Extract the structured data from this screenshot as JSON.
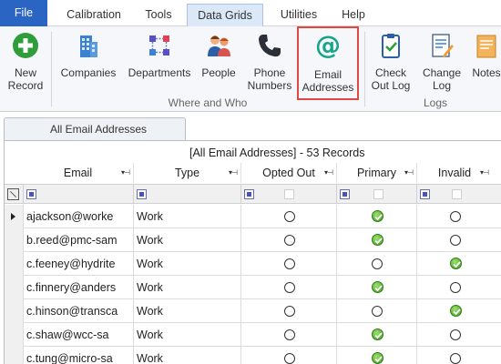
{
  "menu": {
    "file": "File",
    "calibration": "Calibration",
    "tools": "Tools",
    "data_grids": "Data Grids",
    "utilities": "Utilities",
    "help": "Help"
  },
  "ribbon": {
    "new_record": [
      "New",
      "Record"
    ],
    "companies": "Companies",
    "departments": "Departments",
    "people": "People",
    "phone_numbers": [
      "Phone",
      "Numbers"
    ],
    "email_addresses": [
      "Email",
      "Addresses"
    ],
    "check_out_log": [
      "Check",
      "Out Log"
    ],
    "change_log": [
      "Change",
      "Log"
    ],
    "notes": "Notes",
    "group_where_who": "Where and Who",
    "group_logs": "Logs"
  },
  "tab": {
    "label": "All Email Addresses"
  },
  "grid": {
    "caption": "[All Email Addresses] - 53 Records",
    "columns": [
      "Email",
      "Type",
      "Opted Out",
      "Primary",
      "Invalid"
    ],
    "rows": [
      {
        "email": "ajackson@worke",
        "type": "Work",
        "opted_out": false,
        "primary": true,
        "invalid": false,
        "current": true
      },
      {
        "email": "b.reed@pmc-sam",
        "type": "Work",
        "opted_out": false,
        "primary": true,
        "invalid": false
      },
      {
        "email": "c.feeney@hydrite",
        "type": "Work",
        "opted_out": false,
        "primary": false,
        "invalid": true
      },
      {
        "email": "c.finnery@anders",
        "type": "Work",
        "opted_out": false,
        "primary": true,
        "invalid": false
      },
      {
        "email": "c.hinson@transca",
        "type": "Work",
        "opted_out": false,
        "primary": false,
        "invalid": true
      },
      {
        "email": "c.shaw@wcc-sa",
        "type": "Work",
        "opted_out": false,
        "primary": true,
        "invalid": false
      },
      {
        "email": "c.tung@micro-sa",
        "type": "Work",
        "opted_out": false,
        "primary": true,
        "invalid": false
      }
    ]
  },
  "colors": {
    "file_tab": "#2b65c4",
    "active_tab": "#dbe8f7",
    "selected_button_border": "#e04848",
    "check_green": "#3e9b1c",
    "email_icon": "#17a589"
  }
}
